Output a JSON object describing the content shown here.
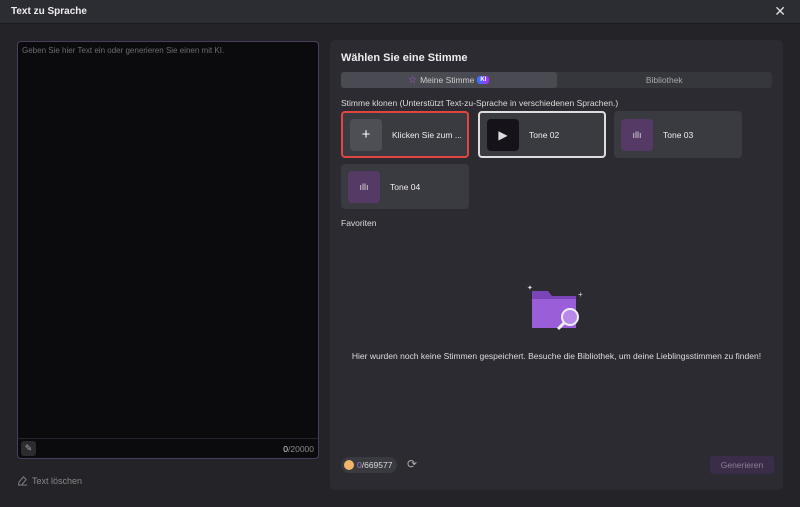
{
  "window": {
    "title": "Text zu Sprache",
    "close": "✕"
  },
  "editor": {
    "placeholder": "Geben Sie hier Text ein oder generieren Sie einen mit KI.",
    "count_current": "0",
    "count_max": "/20000",
    "clear_label": "Text löschen"
  },
  "panel": {
    "heading": "Wählen Sie eine Stimme",
    "tabs": [
      {
        "label": "Meine Stimme",
        "badge": "KI"
      },
      {
        "label": "Bibliothek"
      }
    ],
    "clone_label": "Stimme klonen (Unterstützt Text-zu-Sprache in verschiedenen Sprachen.)",
    "cards": [
      {
        "label": "Klicken Sie zum ..."
      },
      {
        "label": "Tone 02"
      },
      {
        "label": "Tone 03"
      },
      {
        "label": "Tone 04"
      }
    ],
    "favorites_label": "Favoriten",
    "empty_message": "Hier wurden noch keine Stimmen gespeichert. Besuche die Bibliothek, um deine Lieblingsstimmen zu finden!",
    "credits_used": "0",
    "credits_total": "/669577",
    "generate_label": "Generieren"
  },
  "colors": {
    "accent": "#8a4fd0",
    "highlight_border": "#e0463f"
  }
}
